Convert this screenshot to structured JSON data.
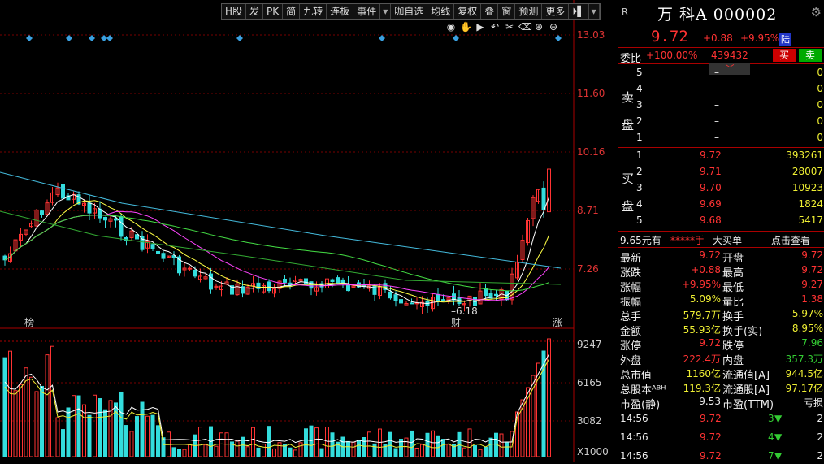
{
  "toolbar": {
    "items": [
      "H股",
      "发",
      "PK",
      "简",
      "九转",
      "连板",
      "事件",
      "▾",
      "咖自选",
      "均线",
      "复权",
      "叠",
      "窗",
      "预测",
      "更多",
      "⏵▌",
      "▾"
    ]
  },
  "chart_icons": [
    "eye-icon",
    "hand-icon",
    "play-icon",
    "undo-icon",
    "scissors-icon",
    "clear-icon",
    "zoom-in-icon",
    "zoom-out-icon"
  ],
  "chart_icon_glyphs": [
    "◉",
    "✋",
    "▶",
    "↶",
    "✂",
    "⌫",
    "⊕",
    "⊖"
  ],
  "price_axis": [
    "13.03",
    "11.60",
    "10.16",
    "8.71",
    "7.26"
  ],
  "volume_axis": [
    "9247",
    "6165",
    "3082",
    "X1000"
  ],
  "chart_markers": {
    "bang": "榜",
    "cai": "财",
    "zhang": "涨",
    "low_label": "6.18"
  },
  "quote": {
    "r": "R",
    "name": "万 科A 000002",
    "price": "9.72",
    "change": "+0.88",
    "pct": "+9.95%",
    "market_tag": "陆",
    "weibi_label": "委比",
    "weibi_value": "+100.00%",
    "weibi_diff": "439432",
    "buy_btn": "买",
    "sell_btn": "卖",
    "sell_label": "卖\n盘",
    "buy_label": "买\n盘",
    "asks": [
      {
        "lvl": "5",
        "price": "–",
        "vol": "0"
      },
      {
        "lvl": "4",
        "price": "–",
        "vol": "0"
      },
      {
        "lvl": "3",
        "price": "–",
        "vol": "0"
      },
      {
        "lvl": "2",
        "price": "–",
        "vol": "0"
      },
      {
        "lvl": "1",
        "price": "–",
        "vol": "0"
      }
    ],
    "bids": [
      {
        "lvl": "1",
        "price": "9.72",
        "vol": "393261"
      },
      {
        "lvl": "2",
        "price": "9.71",
        "vol": "28007"
      },
      {
        "lvl": "3",
        "price": "9.70",
        "vol": "10923"
      },
      {
        "lvl": "4",
        "price": "9.69",
        "vol": "1824"
      },
      {
        "lvl": "5",
        "price": "9.68",
        "vol": "5417"
      }
    ],
    "big_order": {
      "price": "9.65元有",
      "stars": "*****手",
      "label": "大买单",
      "link": "点击查看"
    },
    "stats": [
      {
        "l1": "最新",
        "v1": "9.72",
        "c1": "red",
        "l2": "开盘",
        "v2": "9.72",
        "c2": "red"
      },
      {
        "l1": "涨跌",
        "v1": "+0.88",
        "c1": "red",
        "l2": "最高",
        "v2": "9.72",
        "c2": "red"
      },
      {
        "l1": "涨幅",
        "v1": "+9.95%",
        "c1": "red",
        "l2": "最低",
        "v2": "9.27",
        "c2": "red"
      },
      {
        "l1": "振幅",
        "v1": "5.09%",
        "c1": "yellow",
        "l2": "量比",
        "v2": "1.38",
        "c2": "red"
      },
      {
        "l1": "总手",
        "v1": "579.7万",
        "c1": "yellow",
        "l2": "换手",
        "v2": "5.97%",
        "c2": "yellow"
      },
      {
        "l1": "金额",
        "v1": "55.93亿",
        "c1": "yellow",
        "l2": "换手(实)",
        "v2": "8.95%",
        "c2": "yellow"
      },
      {
        "l1": "涨停",
        "v1": "9.72",
        "c1": "red",
        "l2": "跌停",
        "v2": "7.96",
        "c2": "green"
      },
      {
        "l1": "外盘",
        "v1": "222.4万",
        "c1": "red",
        "l2": "内盘",
        "v2": "357.3万",
        "c2": "green"
      },
      {
        "l1": "总市值",
        "v1": "1160亿",
        "c1": "yellow",
        "l2": "流通值[A]",
        "v2": "944.5亿",
        "c2": "yellow"
      },
      {
        "l1": "总股本ᴬᴮᴴ",
        "v1": "119.3亿",
        "c1": "yellow",
        "l2": "流通股[A]",
        "v2": "97.17亿",
        "c2": "yellow"
      },
      {
        "l1": "市盈(静)",
        "v1": "9.53",
        "c1": "white",
        "l2": "市盈(TTM)",
        "v2": "亏损",
        "c2": "white"
      }
    ],
    "ticks": [
      {
        "time": "14:56",
        "price": "9.72",
        "vol": "3",
        "dir": "▼",
        "n": "2"
      },
      {
        "time": "14:56",
        "price": "9.72",
        "vol": "4",
        "dir": "▼",
        "n": "2"
      },
      {
        "time": "14:56",
        "price": "9.72",
        "vol": "7",
        "dir": "▼",
        "n": "2"
      }
    ]
  },
  "colors": {
    "up": "#ff3333",
    "down": "#33dddd",
    "accent": "#cc0000"
  }
}
